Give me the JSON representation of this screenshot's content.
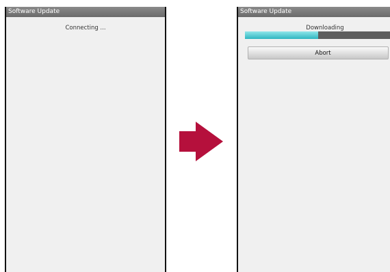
{
  "left_screen": {
    "title": "Software Update",
    "status": "Connecting ..."
  },
  "right_screen": {
    "title": "Software Update",
    "status": "Downloading",
    "progress_fraction": 0.5,
    "abort_label": "Abort"
  },
  "transition_arrow": {
    "icon": "arrow-right-icon",
    "color": "#b5103c"
  },
  "colors": {
    "title_bar": "#777777",
    "screen_bg": "#f0f0f0",
    "progress_fill": "#3ab8c2",
    "progress_track": "#5e5e5e"
  }
}
